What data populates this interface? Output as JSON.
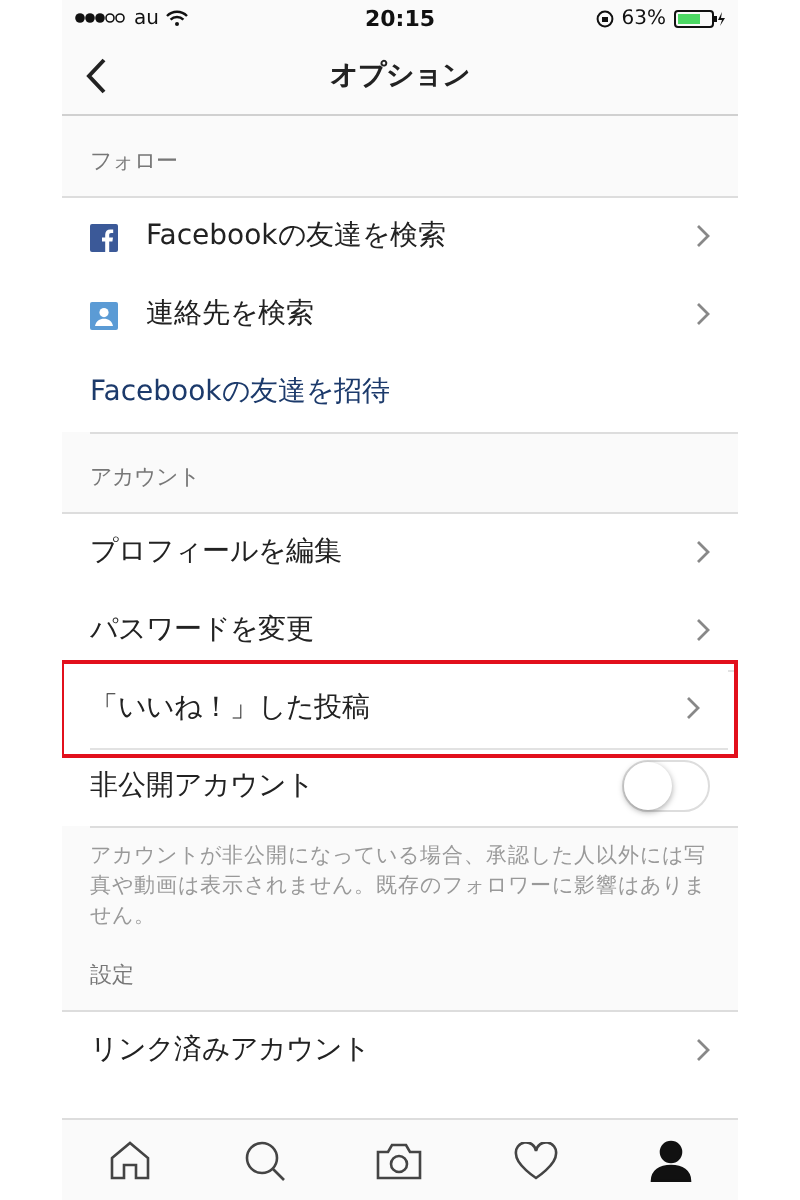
{
  "status_bar": {
    "carrier": "au",
    "time": "20:15",
    "battery": "63%"
  },
  "nav": {
    "title": "オプション"
  },
  "sections": [
    {
      "header": "フォロー",
      "items": [
        {
          "kind": "facebook_link",
          "label": "Facebookの友達を検索",
          "highlighted": false
        },
        {
          "kind": "contacts_link",
          "label": "連絡先を検索",
          "highlighted": false
        },
        {
          "kind": "action",
          "label": "Facebookの友達を招待",
          "highlighted": false
        }
      ]
    },
    {
      "header": "アカウント",
      "items": [
        {
          "kind": "link",
          "label": "プロフィールを編集",
          "highlighted": false
        },
        {
          "kind": "link",
          "label": "パスワードを変更",
          "highlighted": false
        },
        {
          "kind": "link",
          "label": "「いいね！」した投稿",
          "highlighted": true
        },
        {
          "kind": "toggle",
          "label": "非公開アカウント",
          "on": false,
          "highlighted": false
        }
      ],
      "footer": "アカウントが非公開になっている場合、承認した人以外には写真や動画は表示されません。既存のフォロワーに影響はありません。"
    },
    {
      "header": "設定",
      "items": [
        {
          "kind": "link",
          "label": "リンク済みアカウント",
          "highlighted": false
        }
      ]
    }
  ],
  "tab_bar": [
    {
      "selected": false
    },
    {
      "selected": false
    },
    {
      "selected": false
    },
    {
      "selected": false
    },
    {
      "selected": true
    }
  ]
}
